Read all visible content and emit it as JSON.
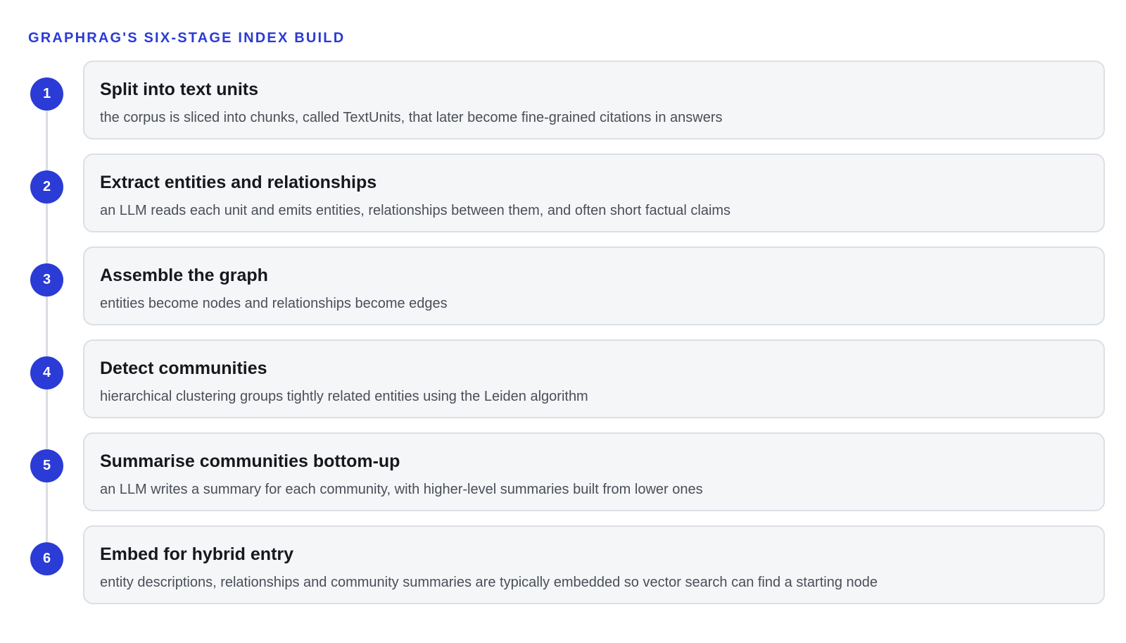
{
  "heading": "GRAPHRAG'S SIX-STAGE INDEX BUILD",
  "colors": {
    "accent": "#2a3bd6",
    "card_background": "#f5f6f8",
    "card_border": "#dcdfe5",
    "timeline": "#d9dce3"
  },
  "stages": [
    {
      "number": "1",
      "title": "Split into text units",
      "description": "the corpus is sliced into chunks, called TextUnits, that later become fine-grained citations in answers"
    },
    {
      "number": "2",
      "title": "Extract entities and relationships",
      "description": "an LLM reads each unit and emits entities, relationships between them, and often short factual claims"
    },
    {
      "number": "3",
      "title": "Assemble the graph",
      "description": "entities become nodes and relationships become edges"
    },
    {
      "number": "4",
      "title": "Detect communities",
      "description": "hierarchical clustering groups tightly related entities using the Leiden algorithm"
    },
    {
      "number": "5",
      "title": "Summarise communities bottom-up",
      "description": "an LLM writes a summary for each community, with higher-level summaries built from lower ones"
    },
    {
      "number": "6",
      "title": "Embed for hybrid entry",
      "description": "entity descriptions, relationships and community summaries are typically embedded so vector search can find a starting node"
    }
  ]
}
